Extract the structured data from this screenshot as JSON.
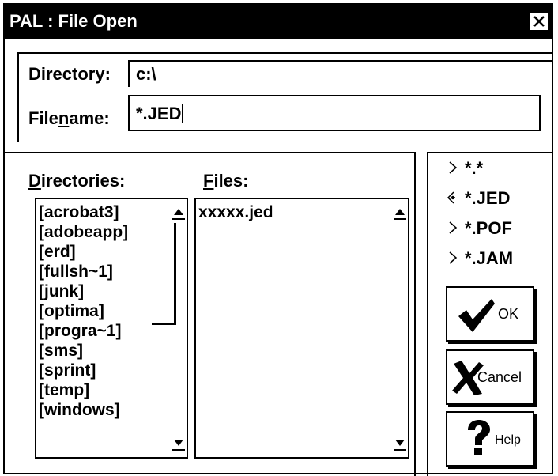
{
  "window": {
    "title": "PAL : File Open"
  },
  "directory": {
    "label": "Directory:",
    "value": "c:\\"
  },
  "filename": {
    "label_pre": "File",
    "label_accel": "n",
    "label_post": "ame:",
    "value": "*.JED"
  },
  "directories": {
    "label_accel": "D",
    "label_rest": "irectories:",
    "items": [
      "[acrobat3]",
      "[adobeapp]",
      "[erd]",
      "[fullsh~1]",
      "[junk]",
      "[optima]",
      "[progra~1]",
      "[sms]",
      "[sprint]",
      "[temp]",
      "[windows]"
    ]
  },
  "files": {
    "label_accel": "F",
    "label_rest": "iles:",
    "items": [
      "xxxxx.jed"
    ]
  },
  "filters": {
    "items": [
      "*.*",
      "*.JED",
      "*.POF",
      "*.JAM"
    ],
    "selected": "*.JED",
    "selected_icon": "diamond-pointer-icon",
    "unselected_icon": "chevron-right-icon"
  },
  "buttons": {
    "ok": {
      "label": "OK",
      "icon": "checkmark-icon"
    },
    "cancel": {
      "label": "Cancel",
      "icon": "x-mark-icon"
    },
    "help": {
      "label": "Help",
      "icon": "question-mark-icon"
    }
  }
}
